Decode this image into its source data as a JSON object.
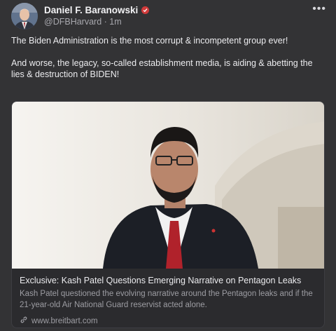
{
  "author": {
    "name": "Daniel F. Baranowski",
    "handle": "@DFBHarvard",
    "time": "1m",
    "separator": "·"
  },
  "post": {
    "paragraph1": "The Biden Administration is the most corrupt & incompetent group ever!",
    "paragraph2": "And worse, the legacy, so-called establishment media, is aiding & abetting the lies & destruction of BIDEN!"
  },
  "link_card": {
    "title": "Exclusive: Kash Patel Questions Emerging Narrative on Pentagon Leaks",
    "description": "Kash Patel questioned the evolving narrative around the Pentagon leaks and if the 21-year-old Air National Guard reservist acted alone.",
    "domain": "www.breitbart.com"
  },
  "icons": {
    "more": "more-options-icon",
    "verified": "verified-badge-icon",
    "link": "link-icon"
  },
  "colors": {
    "background": "#333335",
    "verified_badge": "#d03a3a",
    "tie": "#b0222b"
  }
}
